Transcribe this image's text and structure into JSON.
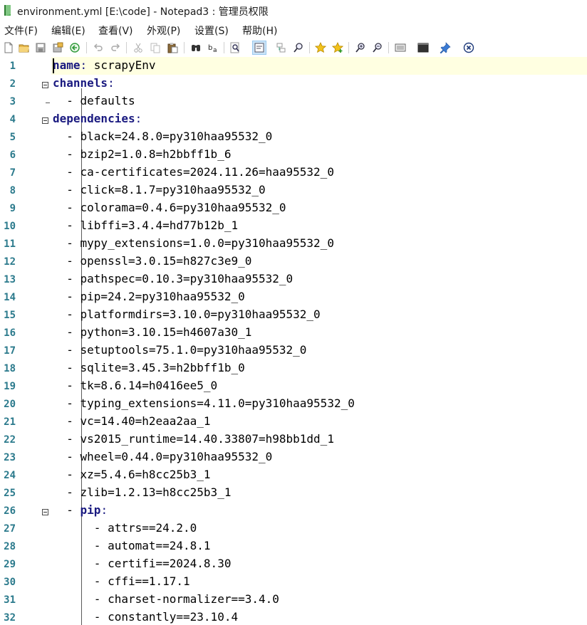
{
  "window": {
    "title": "environment.yml [E:\\code] - Notepad3 : 管理员权限"
  },
  "menu": [
    "文件(F)",
    "编辑(E)",
    "查看(V)",
    "外观(P)",
    "设置(S)",
    "帮助(H)"
  ],
  "toolbar": [
    "new-file-icon",
    "open-folder-icon",
    "save-icon",
    "save-as-icon",
    "reload-icon",
    "undo-icon",
    "redo-icon",
    "cut-icon",
    "copy-icon",
    "paste-icon",
    "find-icon",
    "replace-icon",
    "find-in-files-icon",
    "word-wrap-icon",
    "goto-icon",
    "zoom-selection-icon",
    "favorite-icon",
    "add-favorite-icon",
    "zoom-in-icon",
    "zoom-out-icon",
    "schema-icon",
    "terminal-icon",
    "pin-icon",
    "close-icon"
  ],
  "colors": {
    "line_number": "#2b7a8c",
    "keyword": "#1a1a80",
    "current_line": "#ffffe1"
  },
  "editor": {
    "lines": [
      {
        "n": "1",
        "key": "name",
        "sep": ": ",
        "val": "scrapyEnv",
        "indent": ""
      },
      {
        "n": "2",
        "key": "channels",
        "sep": ":",
        "val": "",
        "indent": ""
      },
      {
        "n": "3",
        "key": "",
        "sep": "",
        "val": "- defaults",
        "indent": "  "
      },
      {
        "n": "4",
        "key": "dependencies",
        "sep": ":",
        "val": "",
        "indent": ""
      },
      {
        "n": "5",
        "key": "",
        "sep": "",
        "val": "- black=24.8.0=py310haa95532_0",
        "indent": "  "
      },
      {
        "n": "6",
        "key": "",
        "sep": "",
        "val": "- bzip2=1.0.8=h2bbff1b_6",
        "indent": "  "
      },
      {
        "n": "7",
        "key": "",
        "sep": "",
        "val": "- ca-certificates=2024.11.26=haa95532_0",
        "indent": "  "
      },
      {
        "n": "8",
        "key": "",
        "sep": "",
        "val": "- click=8.1.7=py310haa95532_0",
        "indent": "  "
      },
      {
        "n": "9",
        "key": "",
        "sep": "",
        "val": "- colorama=0.4.6=py310haa95532_0",
        "indent": "  "
      },
      {
        "n": "10",
        "key": "",
        "sep": "",
        "val": "- libffi=3.4.4=hd77b12b_1",
        "indent": "  "
      },
      {
        "n": "11",
        "key": "",
        "sep": "",
        "val": "- mypy_extensions=1.0.0=py310haa95532_0",
        "indent": "  "
      },
      {
        "n": "12",
        "key": "",
        "sep": "",
        "val": "- openssl=3.0.15=h827c3e9_0",
        "indent": "  "
      },
      {
        "n": "13",
        "key": "",
        "sep": "",
        "val": "- pathspec=0.10.3=py310haa95532_0",
        "indent": "  "
      },
      {
        "n": "14",
        "key": "",
        "sep": "",
        "val": "- pip=24.2=py310haa95532_0",
        "indent": "  "
      },
      {
        "n": "15",
        "key": "",
        "sep": "",
        "val": "- platformdirs=3.10.0=py310haa95532_0",
        "indent": "  "
      },
      {
        "n": "16",
        "key": "",
        "sep": "",
        "val": "- python=3.10.15=h4607a30_1",
        "indent": "  "
      },
      {
        "n": "17",
        "key": "",
        "sep": "",
        "val": "- setuptools=75.1.0=py310haa95532_0",
        "indent": "  "
      },
      {
        "n": "18",
        "key": "",
        "sep": "",
        "val": "- sqlite=3.45.3=h2bbff1b_0",
        "indent": "  "
      },
      {
        "n": "19",
        "key": "",
        "sep": "",
        "val": "- tk=8.6.14=h0416ee5_0",
        "indent": "  "
      },
      {
        "n": "20",
        "key": "",
        "sep": "",
        "val": "- typing_extensions=4.11.0=py310haa95532_0",
        "indent": "  "
      },
      {
        "n": "21",
        "key": "",
        "sep": "",
        "val": "- vc=14.40=h2eaa2aa_1",
        "indent": "  "
      },
      {
        "n": "22",
        "key": "",
        "sep": "",
        "val": "- vs2015_runtime=14.40.33807=h98bb1dd_1",
        "indent": "  "
      },
      {
        "n": "23",
        "key": "",
        "sep": "",
        "val": "- wheel=0.44.0=py310haa95532_0",
        "indent": "  "
      },
      {
        "n": "24",
        "key": "",
        "sep": "",
        "val": "- xz=5.4.6=h8cc25b3_1",
        "indent": "  "
      },
      {
        "n": "25",
        "key": "",
        "sep": "",
        "val": "- zlib=1.2.13=h8cc25b3_1",
        "indent": "  "
      },
      {
        "n": "26",
        "key": "pip",
        "sep": ":",
        "val": "",
        "indent": "  - "
      },
      {
        "n": "27",
        "key": "",
        "sep": "",
        "val": "- attrs==24.2.0",
        "indent": "      "
      },
      {
        "n": "28",
        "key": "",
        "sep": "",
        "val": "- automat==24.8.1",
        "indent": "      "
      },
      {
        "n": "29",
        "key": "",
        "sep": "",
        "val": "- certifi==2024.8.30",
        "indent": "      "
      },
      {
        "n": "30",
        "key": "",
        "sep": "",
        "val": "- cffi==1.17.1",
        "indent": "      "
      },
      {
        "n": "31",
        "key": "",
        "sep": "",
        "val": "- charset-normalizer==3.4.0",
        "indent": "      "
      },
      {
        "n": "32",
        "key": "",
        "sep": "",
        "val": "- constantly==23.10.4",
        "indent": "      "
      }
    ],
    "fold_lines": [
      2,
      4,
      26
    ]
  }
}
